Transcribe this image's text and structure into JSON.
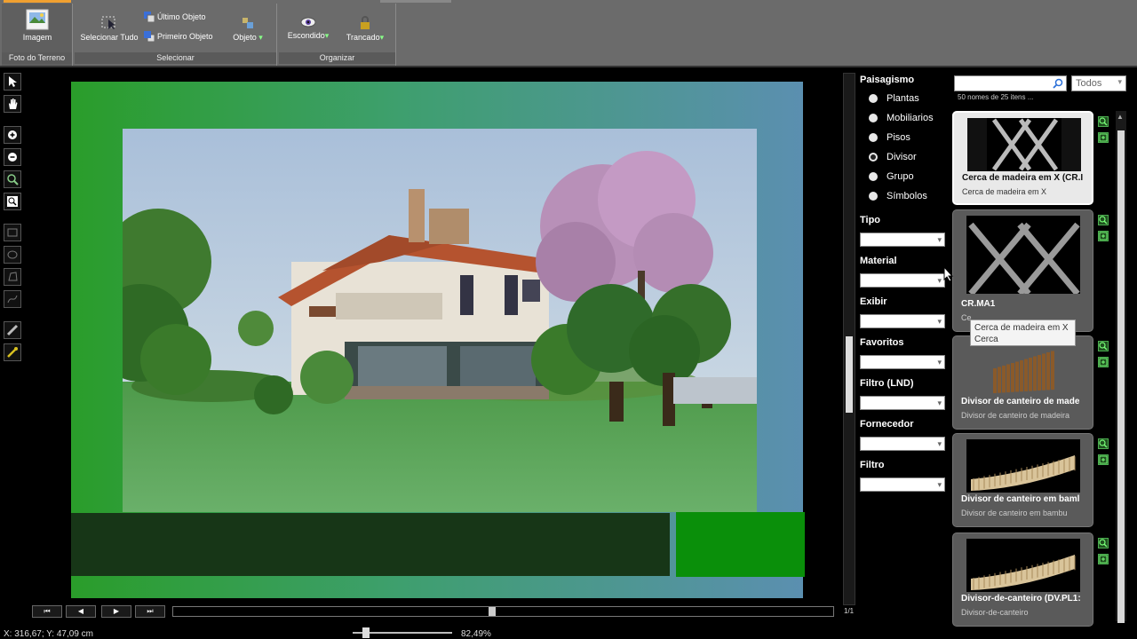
{
  "ribbon": {
    "groups": [
      {
        "label": "Foto do Terreno"
      },
      {
        "label": "Selecionar"
      },
      {
        "label": "Organizar"
      }
    ],
    "buttons": {
      "imagem": "Imagem",
      "selecionar_tudo": "Selecionar Tudo",
      "ultimo_objeto": "Último Objeto",
      "primeiro_objeto": "Primeiro Objeto",
      "objeto": "Objeto",
      "escondido": "Escondido",
      "trancado": "Trancado"
    }
  },
  "nav": {
    "first": "⏮",
    "prev": "◀",
    "next": "▶",
    "last": "⏭",
    "page": "1/1"
  },
  "status": {
    "coords": "X: 316,67; Y: 47,09 cm",
    "zoom": "82,49%",
    "zoom_level": 0.12
  },
  "filters": {
    "title": "Paisagismo",
    "options": [
      "Plantas",
      "Mobiliarios",
      "Pisos",
      "Divisor",
      "Grupo",
      "Símbolos"
    ],
    "selected": "Divisor",
    "fields": [
      "Tipo",
      "Material",
      "Exibir",
      "Favoritos",
      "Filtro (LND)",
      "Fornecedor",
      "Filtro"
    ]
  },
  "library": {
    "category": "Todos",
    "result_count": "50 nomes de 25 itens ...",
    "items": [
      {
        "title": "Cerca de madeira em X (CR.I",
        "subtitle": "Cerca de madeira em X",
        "thumb": "x-fence"
      },
      {
        "title": "CR.MA1",
        "subtitle": "Ce",
        "thumb": "x-fence-dark"
      },
      {
        "title": "Divisor de canteiro de made",
        "subtitle": "Divisor de canteiro de madeira",
        "thumb": "wood-border"
      },
      {
        "title": "Divisor de canteiro em baml",
        "subtitle": "Divisor de canteiro em bambu",
        "thumb": "bamboo-border"
      },
      {
        "title": "Divisor-de-canteiro (DV.PL1:",
        "subtitle": "Divisor-de-canteiro",
        "thumb": "bamboo-border"
      }
    ],
    "tooltip": {
      "line1": "Cerca de madeira em X",
      "line2": "Cerca"
    }
  }
}
